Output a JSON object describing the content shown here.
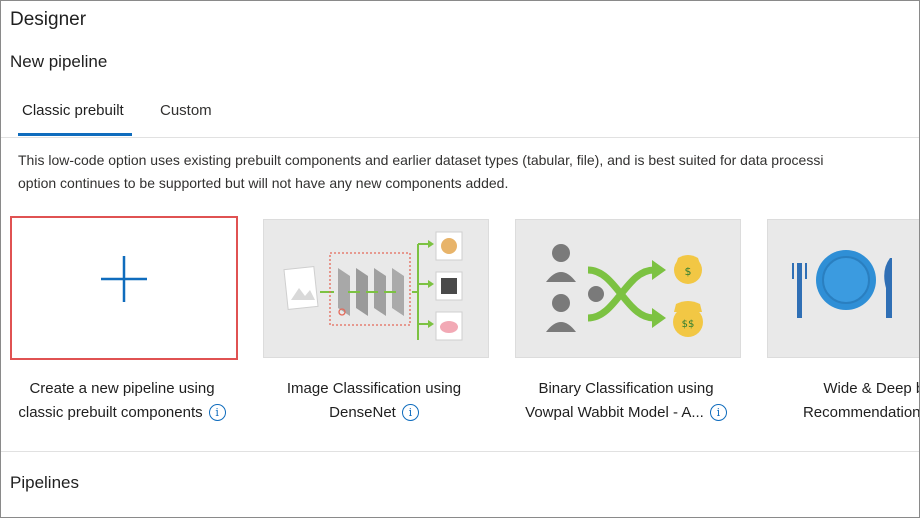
{
  "header": {
    "title": "Designer",
    "subtitle": "New pipeline"
  },
  "tabs": [
    {
      "label": "Classic prebuilt",
      "active": true
    },
    {
      "label": "Custom",
      "active": false
    }
  ],
  "description": {
    "line1": "This low-code option uses existing prebuilt components and earlier dataset types (tabular, file), and is best suited for data processi",
    "line2": "option continues to be supported but will not have any new components added."
  },
  "cards": [
    {
      "line1": "Create a new pipeline using",
      "line2": "classic prebuilt components",
      "icon": "plus-icon"
    },
    {
      "line1": "Image Classification using",
      "line2": "DenseNet",
      "icon": "image-classification-illustration"
    },
    {
      "line1": "Binary Classification using",
      "line2": "Vowpal Wabbit Model - A...",
      "icon": "binary-classification-illustration"
    },
    {
      "line1": "Wide & Deep ba",
      "line2": "Recommendation - Re",
      "icon": "recommendation-illustration"
    }
  ],
  "info_glyph": "i",
  "sections": {
    "pipelines": "Pipelines"
  },
  "colors": {
    "accent": "#0f6cbd",
    "selected_border": "#e05252",
    "arrow_green": "#7cc242",
    "money_yellow": "#f2c744",
    "plate_blue": "#2f8fd6"
  }
}
